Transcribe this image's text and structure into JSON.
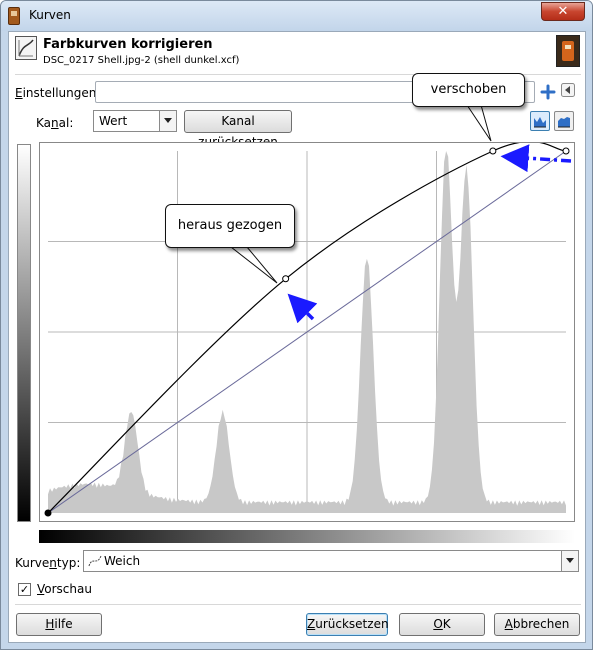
{
  "window": {
    "title": "Kurven",
    "close_glyph": "✕"
  },
  "header": {
    "title": "Farbkurven korrigieren",
    "subtitle": "DSC_0217 Shell.jpg-2 (shell dunkel.xcf)"
  },
  "settings": {
    "label": "Einstellungen:",
    "value": ""
  },
  "channel": {
    "label": "Kanal:",
    "value": "Wert",
    "reset_label": "Kanal zurücksetzen"
  },
  "curve_type": {
    "label": "Kurventyp:",
    "value": "Weich"
  },
  "preview": {
    "label": "Vorschau",
    "checked": true,
    "check_glyph": "✓"
  },
  "buttons": {
    "help": "Hilfe",
    "reset": "Zurücksetzen",
    "ok": "OK",
    "cancel": "Abbrechen"
  },
  "annotations": {
    "moved": "verschoben",
    "pulled_out": "heraus gezogen"
  },
  "icons": {
    "app": "gimp-curves-icon",
    "header": "curves-tool-icon",
    "add": "plus-icon",
    "menu": "triangle-left-icon",
    "linear_hist": "linear-histogram-icon",
    "log_hist": "log-histogram-icon",
    "curve_type": "smooth-curve-icon"
  },
  "colors": {
    "annotation_arrow": "#1a1aff",
    "curve": "#000000",
    "diagonal": "#6a6a9a",
    "histogram": "#c8c8c8"
  },
  "chart_data": {
    "type": "area",
    "x_range": [
      0,
      255
    ],
    "y_range": [
      0,
      255
    ],
    "grid": true,
    "histogram_peaks": [
      {
        "x": 41,
        "height": 0.22
      },
      {
        "x": 86,
        "height": 0.25
      },
      {
        "x": 157,
        "height": 0.68
      },
      {
        "x": 196,
        "height": 0.98
      },
      {
        "x": 206,
        "height": 0.92
      }
    ],
    "curve_points": [
      [
        0,
        0
      ],
      [
        117,
        165
      ],
      [
        219,
        255
      ],
      [
        255,
        255
      ]
    ],
    "diagonal": [
      [
        0,
        0
      ],
      [
        255,
        255
      ]
    ]
  }
}
